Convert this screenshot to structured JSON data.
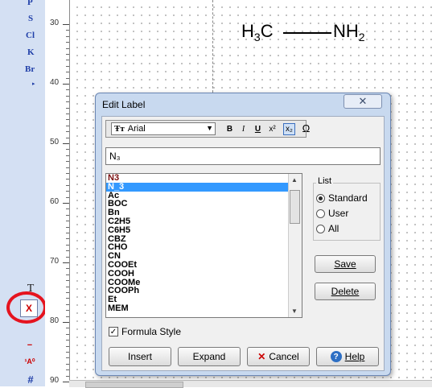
{
  "toolbar": {
    "elements": [
      "P",
      "S",
      "Cl",
      "K",
      "Br"
    ],
    "more_arrow": "▸",
    "tools": [
      {
        "name": "text-tool",
        "glyph": "T"
      },
      {
        "name": "label-tool",
        "glyph": "X"
      },
      {
        "name": "charge-minus-tool",
        "glyph": "−"
      },
      {
        "name": "atom-label-tool",
        "glyph": "¹A⁰"
      },
      {
        "name": "hash-tool",
        "glyph": "#"
      }
    ]
  },
  "ruler": {
    "labels": [
      "30",
      "40",
      "50",
      "60",
      "70",
      "80",
      "90"
    ]
  },
  "molecule": {
    "left_atom": "H",
    "left_sub": "3",
    "left_tail": "C",
    "right_head": "NH",
    "right_sub": "2"
  },
  "dialog": {
    "title": "Edit Label",
    "close_glyph": "✕",
    "font": "Arial",
    "font_icon": "Ŧт",
    "format_buttons": [
      "B",
      "I",
      "U",
      "x²",
      "x₂",
      "Ω"
    ],
    "label_text": "N₃",
    "list_items": [
      "N3",
      "N_3",
      "Ac",
      "BOC",
      "Bn",
      "C2H5",
      "C6H5",
      "CBZ",
      "CHO",
      "CN",
      "COOEt",
      "COOH",
      "COOMe",
      "COOPh",
      "Et",
      "MEM"
    ],
    "selected_index": 1,
    "list_group_label": "List",
    "radios": [
      {
        "label": "Standard",
        "checked": true
      },
      {
        "label": "User",
        "checked": false
      },
      {
        "label": "All",
        "checked": false
      }
    ],
    "save_label": "Save",
    "delete_label": "Delete",
    "formula_label": "Formula Style",
    "formula_checked": true,
    "insert_label": "Insert",
    "expand_label": "Expand",
    "cancel_label": "Cancel",
    "help_label": "Help"
  }
}
